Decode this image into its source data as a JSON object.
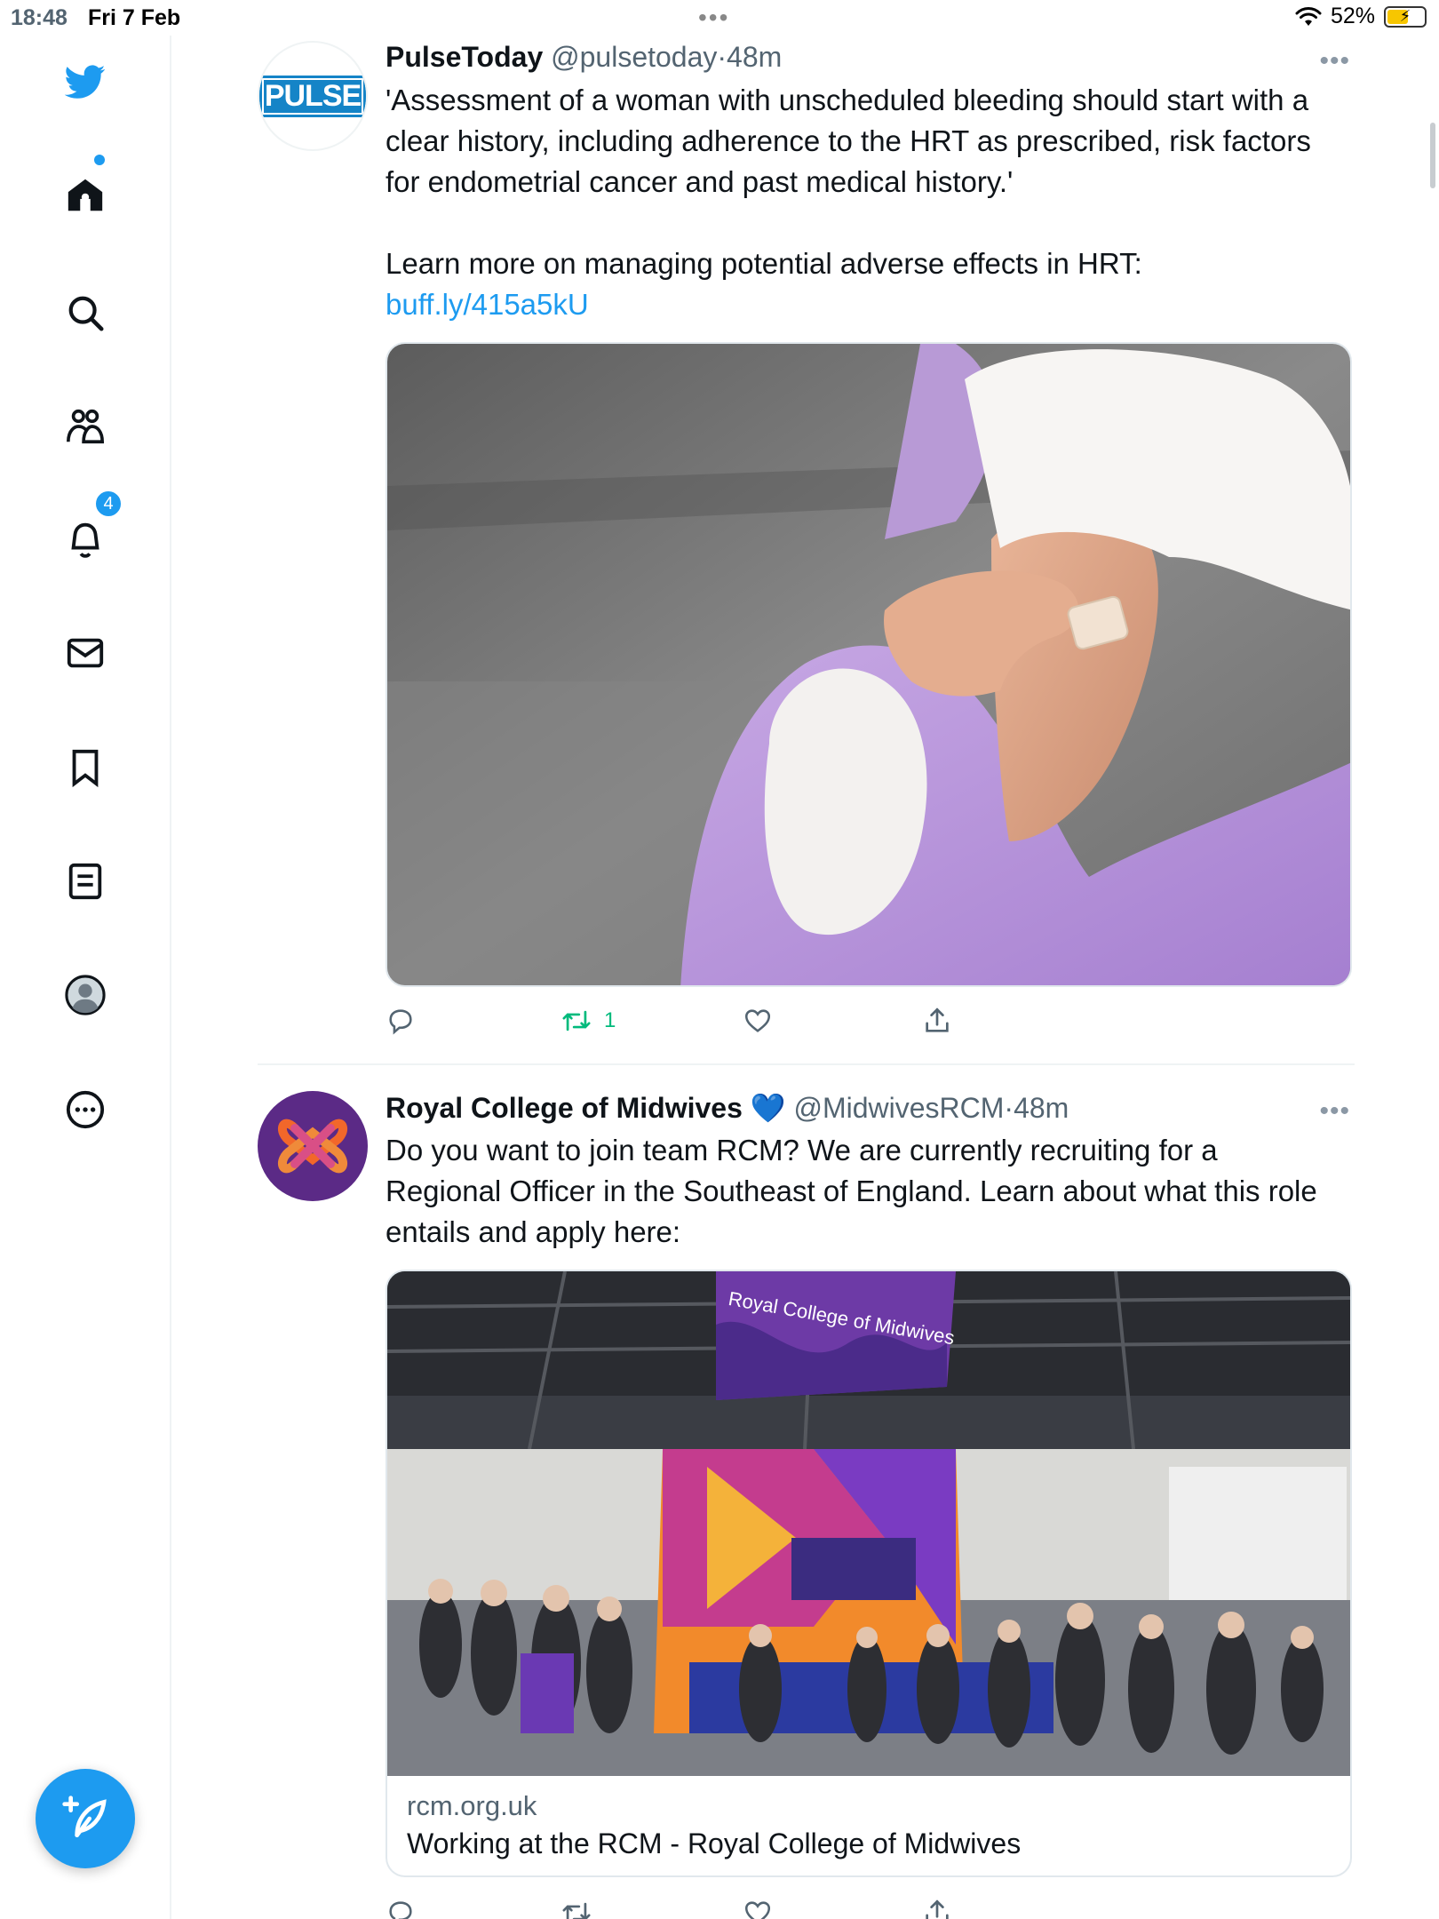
{
  "status_bar": {
    "time": "18:48",
    "date": "Fri 7 Feb",
    "battery": "52%",
    "battery_level": 0.52
  },
  "sidebar": {
    "items": [
      {
        "name": "twitter-bird-icon"
      },
      {
        "name": "home-icon",
        "has_dot": true
      },
      {
        "name": "search-icon"
      },
      {
        "name": "communities-icon"
      },
      {
        "name": "notifications-icon",
        "badge": "4"
      },
      {
        "name": "messages-icon"
      },
      {
        "name": "bookmarks-icon"
      },
      {
        "name": "lists-icon"
      },
      {
        "name": "profile-icon"
      },
      {
        "name": "more-icon"
      }
    ],
    "compose_icon": "compose-feather-icon"
  },
  "tweets": [
    {
      "author": "PulseToday",
      "handle": "@pulsetoday",
      "separator": "·",
      "time": "48m",
      "avatar_text": "PULSE",
      "text_lines": [
        "'Assessment of a woman with unscheduled bleeding should start with a",
        "clear history, including adherence to the HRT as prescribed, risk factors",
        "for endometrial cancer and past medical history.'",
        "",
        "Learn more on managing potential adverse effects in HRT:"
      ],
      "link": "buff.ly/415a5kU",
      "retweets": "1"
    },
    {
      "author": "Royal College of Midwives",
      "verified_emoji": "💙",
      "handle": "@MidwivesRCM",
      "separator": "·",
      "time": "48m",
      "text_lines": [
        "Do you want to join team RCM? We are currently recruiting for a",
        "Regional Officer in the Southeast of England. Learn about what this role",
        "entails and apply here:"
      ],
      "card": {
        "balloon_text": "Royal College of Midwives",
        "domain": "rcm.org.uk",
        "title": "Working at the RCM - Royal College of Midwives"
      }
    }
  ],
  "more_label": "•••",
  "colors": {
    "accent": "#1d9bf0",
    "retweet": "#00ba7c",
    "text": "#0f1419",
    "muted": "#536471",
    "rcm_purple": "#5b2a86",
    "rcm_orange": "#f08a24"
  }
}
